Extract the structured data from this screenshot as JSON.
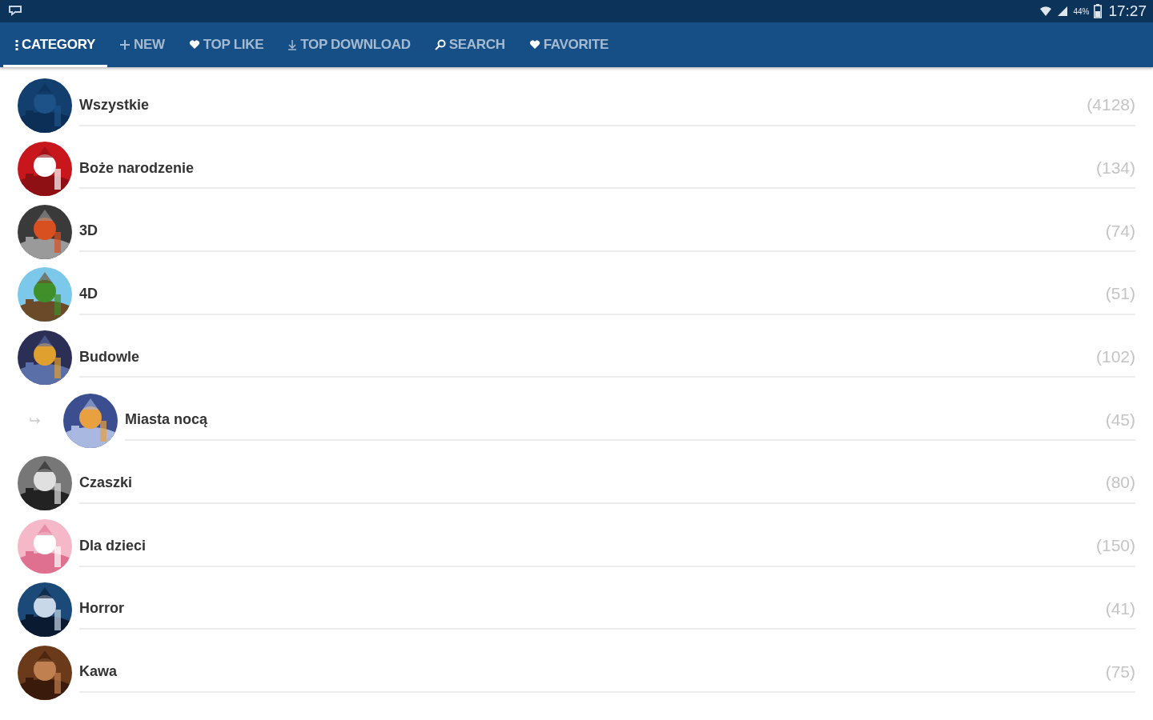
{
  "status_bar": {
    "battery_percent": "44%",
    "time": "17:27"
  },
  "tabs": [
    {
      "label": "CATEGORY",
      "kind": "category",
      "selected": true
    },
    {
      "label": "NEW",
      "kind": "new",
      "selected": false
    },
    {
      "label": "TOP LIKE",
      "kind": "like",
      "selected": false
    },
    {
      "label": "TOP DOWNLOAD",
      "kind": "download",
      "selected": false
    },
    {
      "label": "SEARCH",
      "kind": "search",
      "selected": false
    },
    {
      "label": "FAVORITE",
      "kind": "favorite",
      "selected": false
    }
  ],
  "categories": [
    {
      "name": "Wszystkie",
      "count": "(4128)"
    },
    {
      "name": "Boże narodzenie",
      "count": "(134)"
    },
    {
      "name": "3D",
      "count": "(74)"
    },
    {
      "name": "4D",
      "count": "(51)"
    },
    {
      "name": "Budowle",
      "count": "(102)",
      "children": [
        {
          "name": "Miasta nocą",
          "count": "(45)"
        }
      ]
    },
    {
      "name": "Czaszki",
      "count": "(80)"
    },
    {
      "name": "Dla dzieci",
      "count": "(150)"
    },
    {
      "name": "Horror",
      "count": "(41)"
    },
    {
      "name": "Kawa",
      "count": "(75)"
    }
  ]
}
